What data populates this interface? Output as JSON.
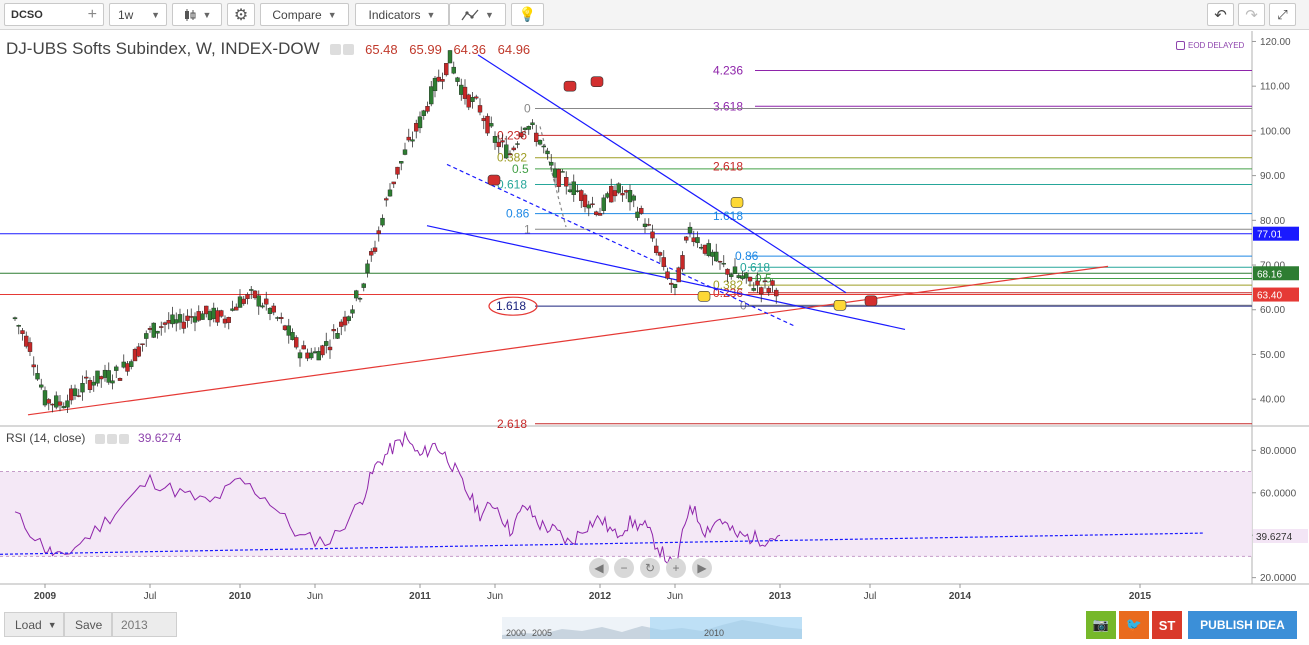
{
  "toolbar": {
    "symbol": "DCSO",
    "interval": "1w",
    "compare": "Compare",
    "indicators": "Indicators"
  },
  "legend": {
    "title": "DJ-UBS Softs Subindex, W, INDEX-DOW",
    "open": "65.48",
    "high": "65.99",
    "low": "64.36",
    "close": "64.96",
    "eod": "EOD DELAYED"
  },
  "rsi": {
    "label": "RSI (14, close)",
    "value": "39.6274"
  },
  "bottom": {
    "load": "Load",
    "save": "Save",
    "year": "2013",
    "nav_years": [
      "2000",
      "2005",
      "2010"
    ],
    "publish": "PUBLISH IDEA",
    "st": "ST"
  },
  "colors": {
    "up": "#2e7d32",
    "down": "#c62828",
    "rsi": "#8e24aa",
    "fib": "#6a1b9a",
    "trend_blue": "#1a1aff",
    "trend_red": "#e53935"
  },
  "icons": [
    "plus-icon",
    "candles-icon",
    "gear-icon",
    "draw-tools-icon",
    "lightbulb-icon",
    "undo-icon",
    "redo-icon",
    "fullscreen-icon",
    "calendar-icon",
    "camera-icon",
    "twitter-icon"
  ],
  "chart_data": [
    {
      "type": "candlestick",
      "title": "DJ-UBS Softs Subindex, W, INDEX-DOW",
      "x_tick_labels": [
        "2009",
        "Jul",
        "2010",
        "Jun",
        "2011",
        "Jun",
        "2012",
        "Jun",
        "2013",
        "Jul",
        "2014",
        "2015"
      ],
      "x": [
        "2008-12",
        "2009-07",
        "2010-01",
        "2010-06",
        "2011-01",
        "2011-06",
        "2012-01",
        "2012-06",
        "2013-01",
        "2013-07",
        "2014-01",
        "2015-01"
      ],
      "y_ticks": [
        40,
        50,
        60,
        70,
        80,
        90,
        100,
        110,
        120
      ],
      "y_tick_labels": [
        "40.00",
        "50.00",
        "60.00",
        "70.00",
        "80.00",
        "90.00",
        "100.00",
        "110.00",
        "120.00"
      ],
      "ylim": [
        34,
        121
      ],
      "series": [
        {
          "x": [
            "2008-10",
            "2008-11",
            "2008-12",
            "2009-01",
            "2009-02",
            "2009-03",
            "2009-04",
            "2009-05",
            "2009-06",
            "2009-07",
            "2009-08",
            "2009-09",
            "2009-10",
            "2009-11",
            "2009-12",
            "2010-01",
            "2010-02",
            "2010-03",
            "2010-04",
            "2010-05",
            "2010-06",
            "2010-07",
            "2010-08",
            "2010-09",
            "2010-10",
            "2010-11",
            "2010-12",
            "2011-01",
            "2011-02",
            "2011-03",
            "2011-04",
            "2011-05",
            "2011-06",
            "2011-07",
            "2011-08",
            "2011-09",
            "2011-10",
            "2011-11",
            "2011-12",
            "2012-01",
            "2012-02",
            "2012-03",
            "2012-04",
            "2012-05",
            "2012-06",
            "2012-07",
            "2012-08",
            "2012-09",
            "2012-10",
            "2012-11",
            "2012-12",
            "2013-01"
          ],
          "values": [
            58,
            52,
            40,
            39,
            41,
            44,
            45,
            46,
            50,
            55,
            57,
            57,
            59,
            59,
            58,
            62,
            63,
            60,
            56,
            51,
            50,
            53,
            58,
            64,
            74,
            87,
            95,
            102,
            110,
            116,
            108,
            105,
            98,
            95,
            102,
            98,
            90,
            88,
            85,
            82,
            87,
            85,
            80,
            72,
            64,
            78,
            74,
            70,
            68,
            66,
            65,
            65
          ]
        }
      ],
      "horizontal_lines": [
        {
          "value": 77.01,
          "label": "77.01"
        },
        {
          "value": 68.16,
          "label": "68.16"
        },
        {
          "value": 63.4,
          "label": "63.40"
        }
      ],
      "fib_labels": [
        "4.236",
        "3.618",
        "2.618",
        "1.618",
        "0",
        "0.236",
        "0.382",
        "0.5",
        "0.618",
        "0.86",
        "1",
        "0.86",
        "0.618",
        "0.5",
        "0.382",
        "0.236",
        "0",
        "1.618",
        "2.618"
      ]
    },
    {
      "type": "line",
      "title": "RSI (14, close)",
      "y_ticks": [
        20,
        40,
        60,
        80
      ],
      "y_tick_labels": [
        "20.0000",
        "40.0000",
        "60.0000",
        "80.0000"
      ],
      "ylim": [
        17,
        91
      ],
      "band": [
        30,
        70
      ],
      "last_value": 39.6274,
      "series": [
        {
          "x": [
            "2008-10",
            "2008-12",
            "2009-01",
            "2009-03",
            "2009-05",
            "2009-07",
            "2009-09",
            "2009-11",
            "2010-01",
            "2010-03",
            "2010-05",
            "2010-07",
            "2010-09",
            "2010-10",
            "2010-11",
            "2010-12",
            "2011-01",
            "2011-02",
            "2011-03",
            "2011-04",
            "2011-05",
            "2011-06",
            "2011-07",
            "2011-08",
            "2011-09",
            "2011-10",
            "2011-11",
            "2011-12",
            "2012-01",
            "2012-02",
            "2012-03",
            "2012-04",
            "2012-05",
            "2012-06",
            "2012-07",
            "2012-08",
            "2012-09",
            "2012-10",
            "2012-11",
            "2012-12",
            "2013-01"
          ],
          "values": [
            50,
            34,
            29,
            40,
            53,
            66,
            60,
            55,
            66,
            56,
            39,
            37,
            55,
            72,
            80,
            86,
            77,
            83,
            75,
            62,
            50,
            55,
            42,
            54,
            45,
            42,
            36,
            44,
            48,
            40,
            46,
            44,
            33,
            24,
            55,
            42,
            48,
            40,
            39,
            38,
            40
          ]
        }
      ]
    }
  ]
}
